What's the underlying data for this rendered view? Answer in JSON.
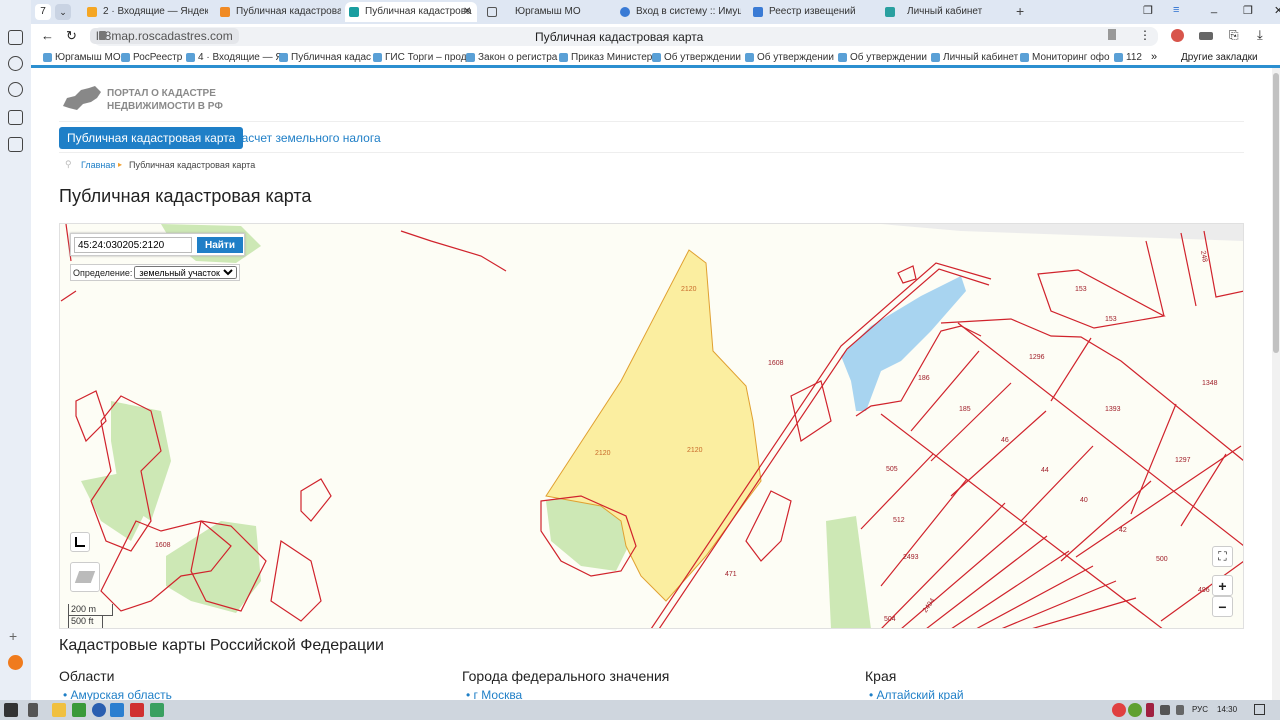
{
  "browser": {
    "tab_count": "7",
    "tabs": [
      {
        "label": "2 · Входящие — Яндекс П",
        "color": "#f5a623"
      },
      {
        "label": "Публичная кадастровая",
        "color": "#f08a24"
      },
      {
        "label": "Публичная кадастрова",
        "color": "#1a9ea0",
        "active": true
      },
      {
        "label": "Юргамыш МО",
        "color": "#fff"
      },
      {
        "label": "Вход в систему :: Имущес",
        "color": "#3a7bd5"
      },
      {
        "label": "Реестр извещений",
        "color": "#3a7bd5"
      },
      {
        "label": "Личный кабинет",
        "color": "#2aa0a0"
      }
    ],
    "url": "lk8map.roscadastres.com",
    "page_title": "Публичная кадастровая карта",
    "bookmarks": [
      "Юргамыш МО",
      "РосРеестр",
      "4 · Входящие — Я",
      "Публичная кадас",
      "ГИС Торги – прод",
      "Закон о регистра",
      "Приказ Министер",
      "Об утверждении",
      "Об утверждении",
      "Об утверждении",
      "Личный кабинет",
      "Мониторинг офо",
      "112"
    ],
    "more_bookmarks": "»",
    "other_bookmarks": "Другие закладки"
  },
  "site": {
    "logo_line1": "ПОРТАЛ О КАДАСТРЕ",
    "logo_line2": "НЕДВИЖИМОСТИ В РФ",
    "nav": [
      "Публичная кадастровая карта",
      "Расчет земельного налога"
    ],
    "breadcrumb": {
      "home": "Главная",
      "sep": "▸",
      "current": "Публичная кадастровая карта"
    },
    "title": "Публичная кадастровая карта"
  },
  "map": {
    "search_value": "45:24:030205:2120",
    "search_button": "Найти",
    "definition_label": "Определение:",
    "definition_value": "земельный участок",
    "scale_m": "200 m",
    "scale_ft": "500 ft",
    "zoom_in": "+",
    "zoom_out": "−",
    "labels": [
      "2120",
      "2120",
      "2120",
      "1608",
      "1608",
      "153",
      "153",
      "248",
      "1296",
      "1348",
      "186",
      "185",
      "1393",
      "46",
      "44",
      "1297",
      "505",
      "40",
      "512",
      "42",
      "2493",
      "500",
      "471",
      "496",
      "504",
      "2494"
    ],
    "colors": {
      "parcel": "#d0232c",
      "selected_fill": "#fbeea0",
      "forest": "#cde8b5",
      "water": "#a8d4f0",
      "background": "#fdfdf5"
    }
  },
  "bottom": {
    "heading": "Кадастровые карты Российской Федерации",
    "columns": [
      {
        "title": "Области",
        "items": [
          "Амурская область"
        ]
      },
      {
        "title": "Города федерального значения",
        "items": [
          "г Москва"
        ]
      },
      {
        "title": "Края",
        "items": [
          "Алтайский край"
        ]
      }
    ]
  },
  "taskbar": {
    "lang": "РУС",
    "time": "14:30"
  }
}
